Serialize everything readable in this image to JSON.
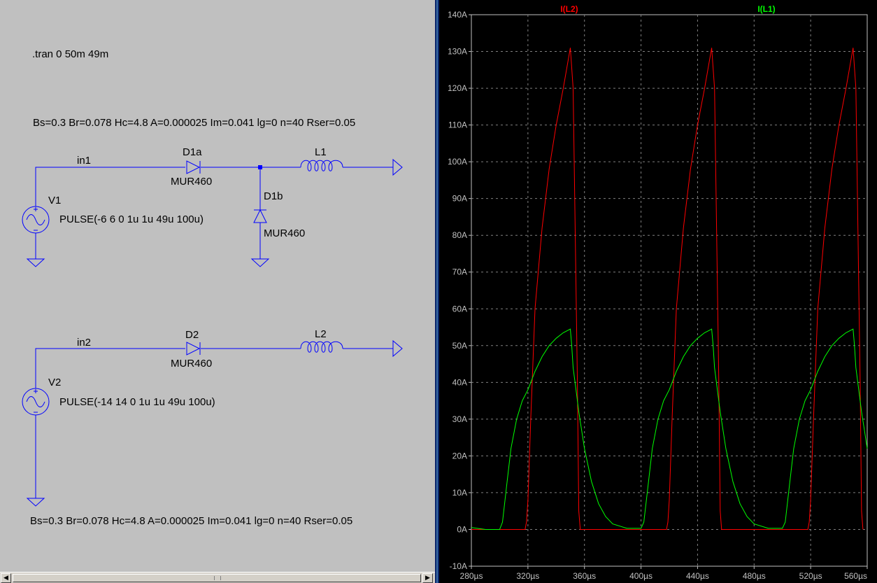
{
  "schematic": {
    "directive": ".tran 0 50m 49m",
    "core_params_top": "Bs=0.3 Br=0.078 Hc=4.8 A=0.000025 Im=0.041 lg=0 n=40 Rser=0.05",
    "core_params_bottom": "Bs=0.3 Br=0.078 Hc=4.8 A=0.000025 Im=0.041 lg=0 n=40 Rser=0.05",
    "circuit1": {
      "net_label": "in1",
      "source_name": "V1",
      "source_value": "PULSE(-6 6 0 1u 1u 49u 100u)",
      "diode_a_name": "D1a",
      "diode_a_model": "MUR460",
      "diode_b_name": "D1b",
      "diode_b_model": "MUR460",
      "inductor_name": "L1"
    },
    "circuit2": {
      "net_label": "in2",
      "source_name": "V2",
      "source_value": "PULSE(-14 14 0 1u 1u 49u 100u)",
      "diode_name": "D2",
      "diode_model": "MUR460",
      "inductor_name": "L2"
    },
    "colors": {
      "wire": "#0000ff",
      "background": "#c0c0c0"
    }
  },
  "scrollbar": {
    "left_arrow": "◀",
    "right_arrow": "▶"
  },
  "waveform": {
    "background": "#000000",
    "grid_color": "#808080",
    "chart_data": {
      "type": "line",
      "x_unit": "µs",
      "y_unit": "A",
      "xlim": [
        280,
        560
      ],
      "ylim": [
        -10,
        140
      ],
      "x_ticks": [
        280,
        320,
        360,
        400,
        440,
        480,
        520,
        560
      ],
      "x_tick_labels": [
        "280µs",
        "320µs",
        "360µs",
        "400µs",
        "440µs",
        "480µs",
        "520µs",
        "560µs"
      ],
      "y_ticks": [
        -10,
        0,
        10,
        20,
        30,
        40,
        50,
        60,
        70,
        80,
        90,
        100,
        110,
        120,
        130,
        140
      ],
      "y_tick_labels": [
        "-10A",
        "0A",
        "10A",
        "20A",
        "30A",
        "40A",
        "50A",
        "60A",
        "70A",
        "80A",
        "90A",
        "100A",
        "110A",
        "120A",
        "130A",
        "140A"
      ],
      "grid": true,
      "legend_position": "top",
      "series": [
        {
          "name": "I(L2)",
          "color": "#ff0000",
          "x": [
            280,
            300,
            310,
            318,
            319,
            320,
            322,
            325,
            330,
            335,
            340,
            345,
            350,
            352,
            355,
            356,
            357,
            360,
            380,
            400,
            418,
            419,
            420,
            422,
            425,
            430,
            435,
            440,
            445,
            450,
            452,
            455,
            456,
            457,
            460,
            480,
            500,
            518,
            519,
            520,
            522,
            525,
            530,
            535,
            540,
            545,
            550,
            552,
            555,
            556,
            557
          ],
          "y": [
            0,
            0,
            0,
            0,
            2,
            8,
            30,
            60,
            82,
            98,
            110,
            120,
            131,
            120,
            40,
            5,
            0,
            0,
            0,
            0,
            0,
            2,
            8,
            30,
            60,
            82,
            98,
            110,
            120,
            131,
            120,
            40,
            5,
            0,
            0,
            0,
            0,
            0,
            2,
            8,
            30,
            60,
            82,
            98,
            110,
            120,
            131,
            120,
            40,
            5,
            0
          ]
        },
        {
          "name": "I(L1)",
          "color": "#00ff00",
          "x": [
            280,
            290,
            300,
            302,
            305,
            308,
            312,
            316,
            320,
            325,
            330,
            335,
            340,
            345,
            350,
            351,
            352,
            354,
            356,
            360,
            365,
            370,
            375,
            380,
            390,
            400,
            402,
            405,
            408,
            412,
            416,
            420,
            425,
            430,
            435,
            440,
            445,
            450,
            451,
            452,
            454,
            456,
            460,
            465,
            470,
            475,
            480,
            490,
            500,
            502,
            505,
            508,
            512,
            516,
            520,
            525,
            530,
            535,
            540,
            545,
            550,
            551,
            552,
            554,
            556,
            558,
            560
          ],
          "y": [
            0.5,
            0,
            0,
            2,
            12,
            22,
            30,
            35,
            38,
            43,
            47,
            50,
            52,
            53.5,
            54.5,
            50,
            44,
            38,
            32,
            22,
            13,
            7,
            3.5,
            1.5,
            0.3,
            0.3,
            2,
            12,
            22,
            30,
            35,
            38,
            43,
            47,
            50,
            52,
            53.5,
            54.5,
            50,
            44,
            38,
            32,
            22,
            13,
            7,
            3.5,
            1.5,
            0.3,
            0.3,
            2,
            12,
            22,
            30,
            35,
            38,
            43,
            47,
            50,
            52,
            53.5,
            54.5,
            50,
            44,
            38,
            32,
            27,
            22
          ]
        }
      ]
    }
  }
}
